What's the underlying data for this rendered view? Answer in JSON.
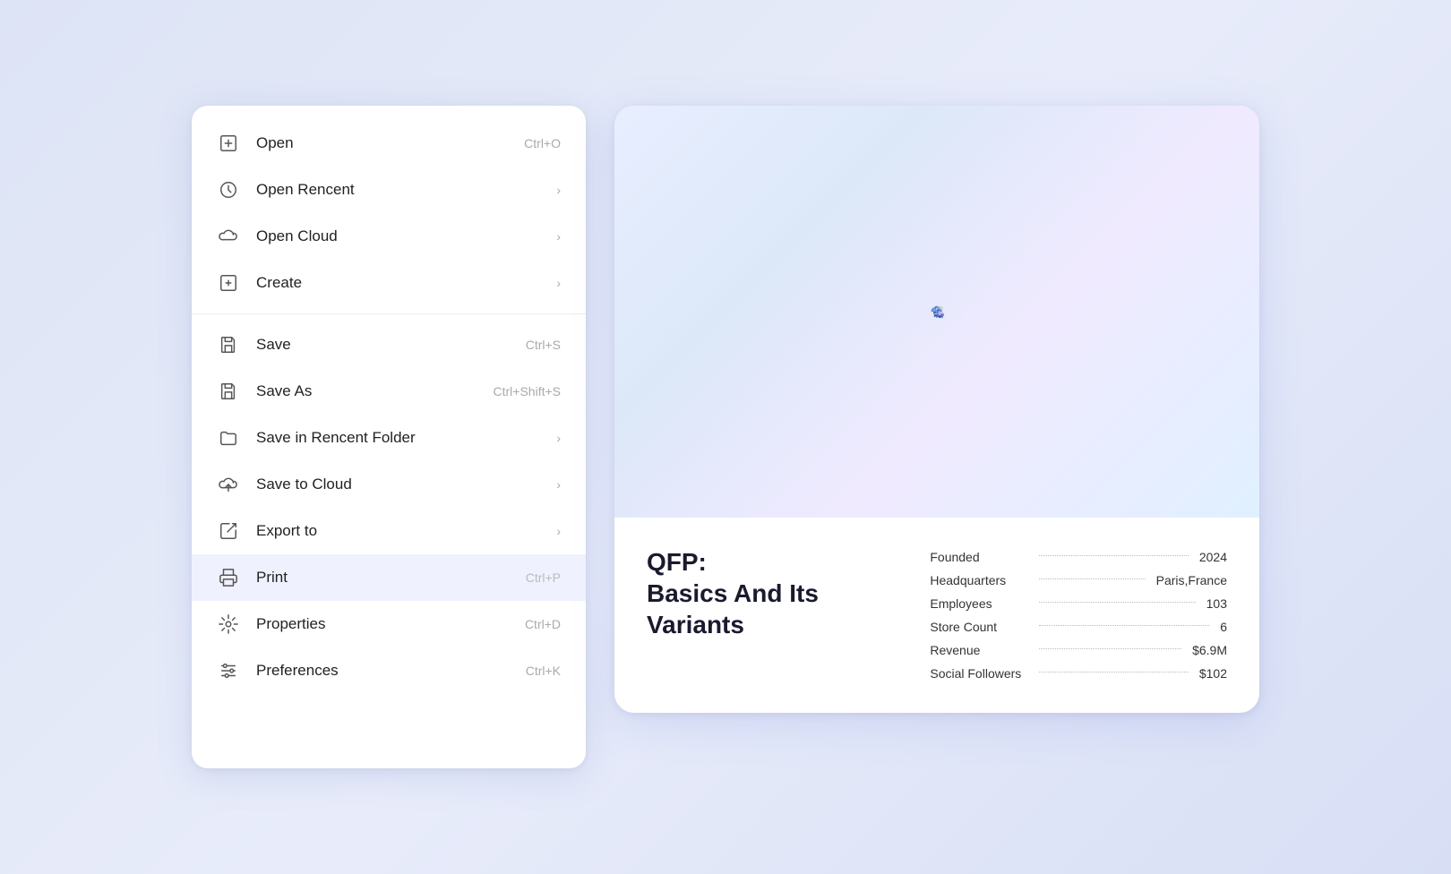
{
  "menu": {
    "items": [
      {
        "id": "open",
        "label": "Open",
        "shortcut": "Ctrl+O",
        "icon": "open-icon",
        "hasArrow": false,
        "hasDividerAfter": false,
        "active": false
      },
      {
        "id": "open-recent",
        "label": "Open Rencent",
        "shortcut": "",
        "icon": "clock-icon",
        "hasArrow": true,
        "hasDividerAfter": false,
        "active": false
      },
      {
        "id": "open-cloud",
        "label": "Open Cloud",
        "shortcut": "",
        "icon": "cloud-icon",
        "hasArrow": true,
        "hasDividerAfter": false,
        "active": false
      },
      {
        "id": "create",
        "label": "Create",
        "shortcut": "",
        "icon": "create-icon",
        "hasArrow": true,
        "hasDividerAfter": true,
        "active": false
      },
      {
        "id": "save",
        "label": "Save",
        "shortcut": "Ctrl+S",
        "icon": "save-icon",
        "hasArrow": false,
        "hasDividerAfter": false,
        "active": false
      },
      {
        "id": "save-as",
        "label": "Save As",
        "shortcut": "Ctrl+Shift+S",
        "icon": "save-as-icon",
        "hasArrow": false,
        "hasDividerAfter": false,
        "active": false
      },
      {
        "id": "save-recent-folder",
        "label": "Save in Rencent Folder",
        "shortcut": "",
        "icon": "folder-icon",
        "hasArrow": true,
        "hasDividerAfter": false,
        "active": false
      },
      {
        "id": "save-cloud",
        "label": "Save to Cloud",
        "shortcut": "",
        "icon": "cloud-upload-icon",
        "hasArrow": true,
        "hasDividerAfter": false,
        "active": false
      },
      {
        "id": "export-to",
        "label": "Export to",
        "shortcut": "",
        "icon": "export-icon",
        "hasArrow": true,
        "hasDividerAfter": false,
        "active": false
      },
      {
        "id": "print",
        "label": "Print",
        "shortcut": "Ctrl+P",
        "icon": "print-icon",
        "hasArrow": false,
        "hasDividerAfter": false,
        "active": true
      },
      {
        "id": "properties",
        "label": "Properties",
        "shortcut": "Ctrl+D",
        "icon": "properties-icon",
        "hasArrow": false,
        "hasDividerAfter": false,
        "active": false
      },
      {
        "id": "preferences",
        "label": "Preferences",
        "shortcut": "Ctrl+K",
        "icon": "preferences-icon",
        "hasArrow": false,
        "hasDividerAfter": false,
        "active": false
      }
    ]
  },
  "document": {
    "title": "QFP:\nBasics And Its\nVariants",
    "stats": [
      {
        "label": "Founded",
        "value": "2024"
      },
      {
        "label": "Headquarters",
        "value": "Paris,France"
      },
      {
        "label": "Employees",
        "value": "103"
      },
      {
        "label": "Store Count",
        "value": "6"
      },
      {
        "label": "Revenue",
        "value": "$6.9M"
      },
      {
        "label": "Social Followers",
        "value": "$102"
      }
    ]
  }
}
